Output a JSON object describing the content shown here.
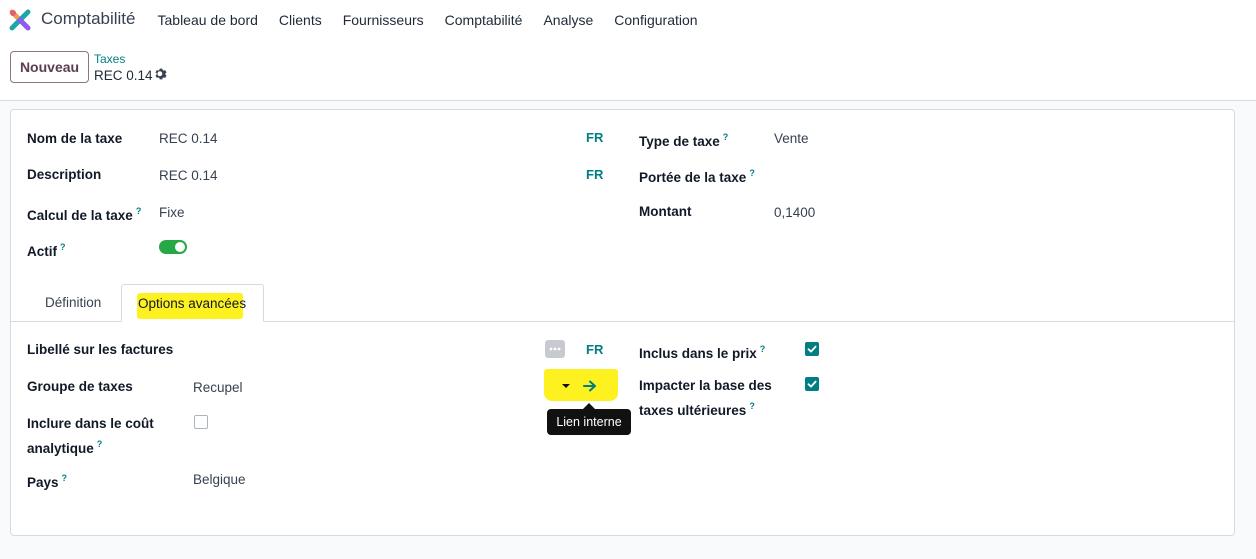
{
  "nav": {
    "app_name": "Comptabilité",
    "items": [
      "Tableau de bord",
      "Clients",
      "Fournisseurs",
      "Comptabilité",
      "Analyse",
      "Configuration"
    ]
  },
  "control": {
    "new_button": "Nouveau",
    "breadcrumb_parent": "Taxes",
    "breadcrumb_current": "REC 0.14"
  },
  "form": {
    "tax_name_label": "Nom de la taxe",
    "tax_name_value": "REC 0.14",
    "description_label": "Description",
    "description_value": "REC 0.14",
    "computation_label": "Calcul de la taxe",
    "computation_value": "Fixe",
    "active_label": "Actif",
    "active": true,
    "lang_tag": "FR",
    "tax_type_label": "Type de taxe",
    "tax_type_value": "Vente",
    "tax_scope_label": "Portée de la taxe",
    "amount_label": "Montant",
    "amount_value": "0,1400",
    "help_mark": "?"
  },
  "tabs": [
    "Définition",
    "Options avancées"
  ],
  "advanced": {
    "invoice_label": "Libellé sur les factures",
    "tax_group_label": "Groupe de taxes",
    "tax_group_value": "Recupel",
    "analytic_label": "Inclure dans le coût analytique",
    "analytic_checked": false,
    "country_label": "Pays",
    "country_value": "Belgique",
    "price_include_label": "Inclus dans le prix",
    "price_include_checked": true,
    "affect_base_label": "Impacter la base des taxes ultérieures",
    "affect_base_checked": true,
    "tooltip": "Lien interne"
  },
  "colors": {
    "accent": "#017e84",
    "brand": "#714b67",
    "highlight": "#fdf21f",
    "toggle_on": "#28a745"
  }
}
